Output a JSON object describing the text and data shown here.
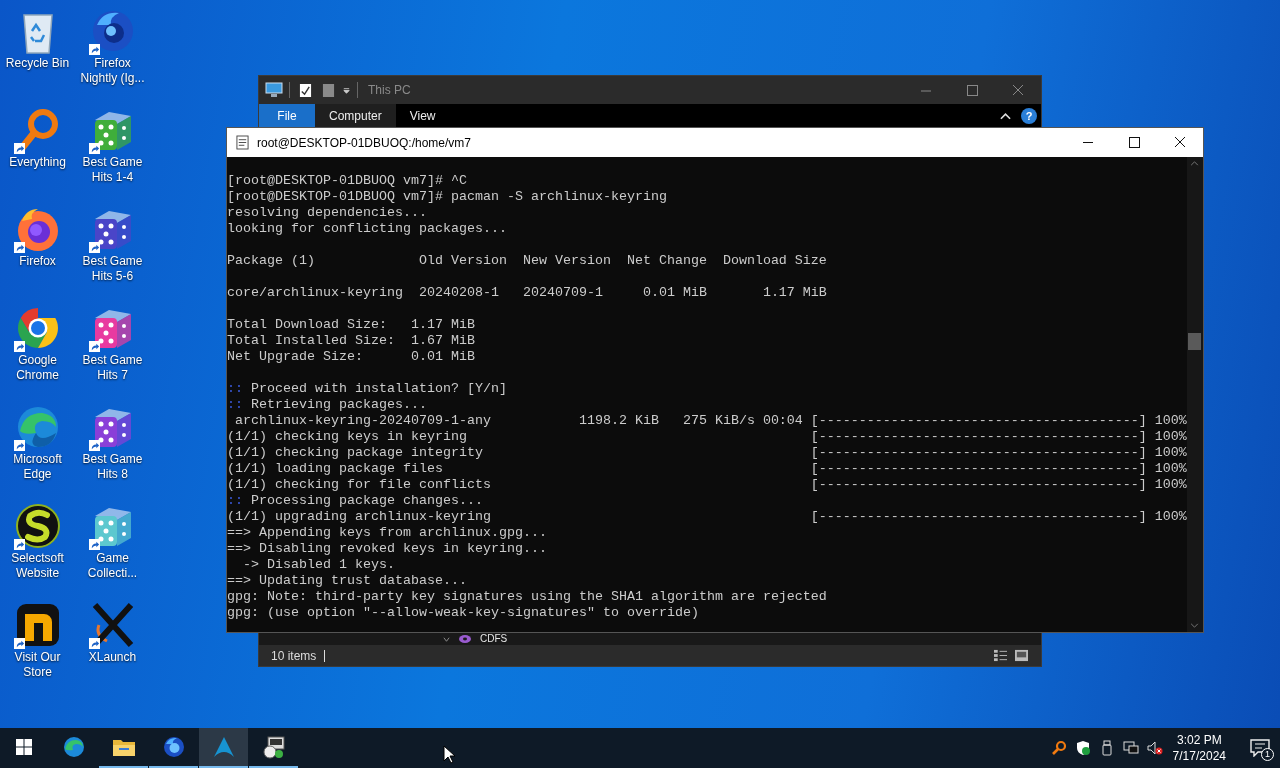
{
  "desktop_icons": [
    {
      "label": "Recycle Bin",
      "kind": "recycle-bin",
      "shortcut": false
    },
    {
      "label": "Everything",
      "kind": "magnifier",
      "shortcut": true
    },
    {
      "label": "Firefox",
      "kind": "firefox",
      "shortcut": true
    },
    {
      "label": "Google Chrome",
      "kind": "chrome",
      "shortcut": true
    },
    {
      "label": "Microsoft Edge",
      "kind": "edge",
      "shortcut": true
    },
    {
      "label": "Selectsoft Website",
      "kind": "swirl",
      "shortcut": true
    },
    {
      "label": "Visit Our Store",
      "kind": "store",
      "shortcut": true
    },
    {
      "label": "Firefox Nightly (Ig...",
      "kind": "globe",
      "shortcut": true
    },
    {
      "label": "Best Game Hits 1-4",
      "kind": "dice",
      "color": "#3fae3a",
      "shortcut": true
    },
    {
      "label": "Best Game Hits 5-6",
      "kind": "dice",
      "color": "#4a45c8",
      "shortcut": true
    },
    {
      "label": "Best Game Hits 7",
      "kind": "dice",
      "color": "#e83aa0",
      "shortcut": true
    },
    {
      "label": "Best Game Hits 8",
      "kind": "dice",
      "color": "#8a3fd8",
      "shortcut": true
    },
    {
      "label": "Game Collecti...",
      "kind": "dice",
      "color": "#5cc8cf",
      "shortcut": true
    },
    {
      "label": "XLaunch",
      "kind": "x-logo",
      "shortcut": true
    }
  ],
  "explorer": {
    "title": "This PC",
    "ribbon_tabs": [
      {
        "label": "File",
        "kind": "file-menu",
        "selected": false
      },
      {
        "label": "Computer",
        "kind": "tab",
        "selected": true
      },
      {
        "label": "View",
        "kind": "tab",
        "selected": false
      }
    ],
    "help": "?",
    "partial_item": "CDFS",
    "status": "10 items"
  },
  "terminal": {
    "title": "root@DESKTOP-01DBUOQ:/home/vm7",
    "lines": [
      {
        "kind": "blank"
      },
      {
        "kind": "text",
        "text": "[root@DESKTOP-01DBUOQ vm7]# ^C"
      },
      {
        "kind": "text",
        "text": "[root@DESKTOP-01DBUOQ vm7]# pacman -S archlinux-keyring"
      },
      {
        "kind": "text",
        "text": "resolving dependencies..."
      },
      {
        "kind": "text",
        "text": "looking for conflicting packages..."
      },
      {
        "kind": "blank"
      },
      {
        "kind": "text",
        "text": "Package (1)             Old Version  New Version  Net Change  Download Size"
      },
      {
        "kind": "blank"
      },
      {
        "kind": "text",
        "text": "core/archlinux-keyring  20240208-1   20240709-1     0.01 MiB       1.17 MiB"
      },
      {
        "kind": "blank"
      },
      {
        "kind": "text",
        "text": "Total Download Size:   1.17 MiB"
      },
      {
        "kind": "text",
        "text": "Total Installed Size:  1.67 MiB"
      },
      {
        "kind": "text",
        "text": "Net Upgrade Size:      0.01 MiB"
      },
      {
        "kind": "blank"
      },
      {
        "kind": "text",
        "marker": "::",
        "text": " Proceed with installation? [Y/n]"
      },
      {
        "kind": "text",
        "marker": "::",
        "text": " Retrieving packages..."
      },
      {
        "kind": "text",
        "text": " archlinux-keyring-20240709-1-any           1198.2 KiB   275 KiB/s 00:04 [----------------------------------------] 100%"
      },
      {
        "kind": "text",
        "text": "(1/1) checking keys in keyring                                           [----------------------------------------] 100%"
      },
      {
        "kind": "text",
        "text": "(1/1) checking package integrity                                         [----------------------------------------] 100%"
      },
      {
        "kind": "text",
        "text": "(1/1) loading package files                                              [----------------------------------------] 100%"
      },
      {
        "kind": "text",
        "text": "(1/1) checking for file conflicts                                        [----------------------------------------] 100%"
      },
      {
        "kind": "text",
        "marker": "::",
        "text": " Processing package changes..."
      },
      {
        "kind": "text",
        "text": "(1/1) upgrading archlinux-keyring                                        [----------------------------------------] 100%"
      },
      {
        "kind": "text",
        "text": "==> Appending keys from archlinux.gpg..."
      },
      {
        "kind": "text",
        "text": "==> Disabling revoked keys in keyring..."
      },
      {
        "kind": "text",
        "text": "  -> Disabled 1 keys."
      },
      {
        "kind": "text",
        "text": "==> Updating trust database..."
      },
      {
        "kind": "text",
        "text": "gpg: Note: third-party key signatures using the SHA1 algorithm are rejected"
      },
      {
        "kind": "text",
        "text": "gpg: (use option \"--allow-weak-key-signatures\" to override)"
      }
    ]
  },
  "taskbar": {
    "apps": [
      {
        "kind": "edge",
        "running": false,
        "selected": false
      },
      {
        "kind": "folder",
        "running": true,
        "selected": false
      },
      {
        "kind": "globe",
        "running": true,
        "selected": false
      },
      {
        "kind": "triangle",
        "running": true,
        "selected": true
      },
      {
        "kind": "tool",
        "running": true,
        "selected": false
      }
    ],
    "time": "3:02 PM",
    "date": "7/17/2024",
    "notifications": "1"
  }
}
